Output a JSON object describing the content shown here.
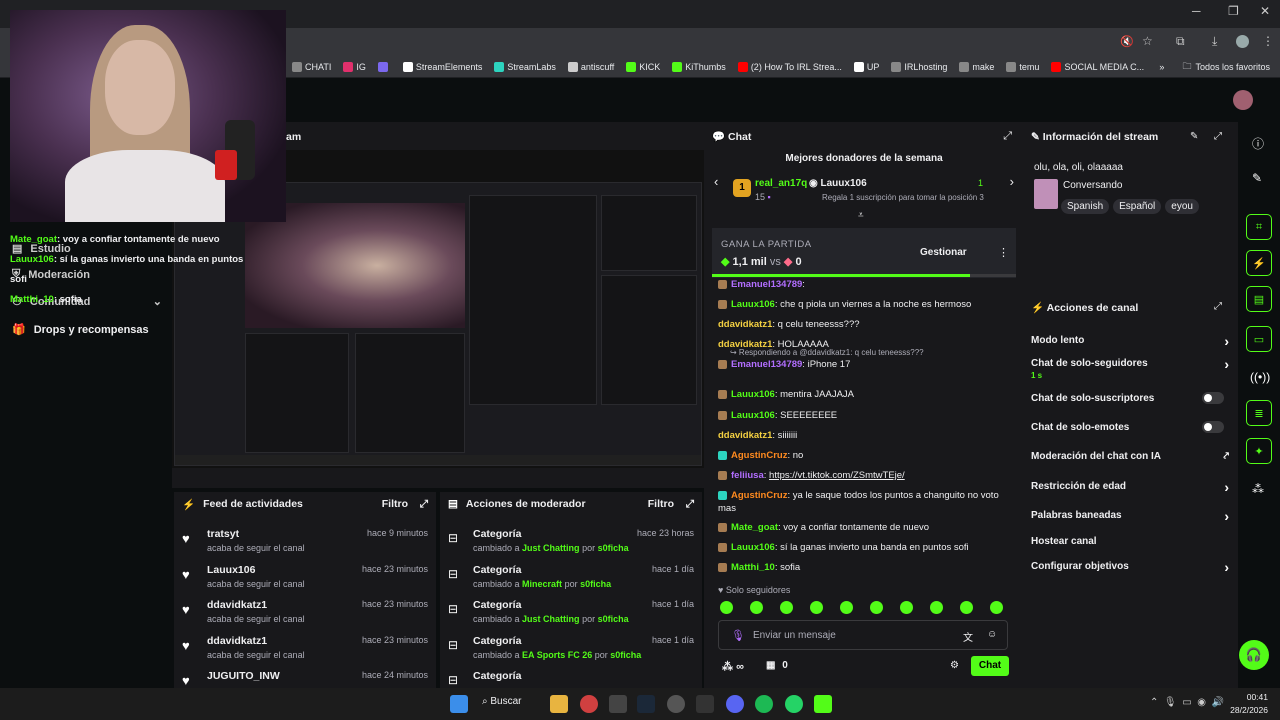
{
  "bookmarks": [
    "CHATI",
    "IG",
    "",
    "StreamElements",
    "StreamLabs",
    "antiscuff",
    "KICK",
    "KiThumbs",
    "(2) How To IRL Strea...",
    "UP",
    "IRLhosting",
    "make",
    "temu",
    "SOCIAL MEDIA C..."
  ],
  "bookmarks_right": "Todos los favoritos",
  "overlay_chat": [
    {
      "user": "Mate_goat",
      "text": "voy a confiar tontamente de nuevo"
    },
    {
      "user": "Lauux106",
      "text": "sí la ganas invierto una banda en puntos"
    },
    {
      "user": "",
      "text": "sofi"
    },
    {
      "user": "Matthi_10",
      "text": "sofia"
    }
  ],
  "left_nav": {
    "estudio": "Estudio",
    "moderacion": "Moderación",
    "comunidad": "Comunidad",
    "drops": "Drops y recompensas"
  },
  "stream_header_suffix": "am",
  "feed": {
    "title": "Feed de actividades",
    "filter": "Filtro",
    "items": [
      {
        "name": "tratsyt",
        "sub": "acaba de seguir el canal",
        "time": "hace 9 minutos"
      },
      {
        "name": "Lauux106",
        "sub": "acaba de seguir el canal",
        "time": "hace 23 minutos"
      },
      {
        "name": "ddavidkatz1",
        "sub": "acaba de seguir el canal",
        "time": "hace 23 minutos"
      },
      {
        "name": "ddavidkatz1",
        "sub": "acaba de seguir el canal",
        "time": "hace 23 minutos"
      },
      {
        "name": "JUGUITO_INW",
        "sub": "",
        "time": "hace 24 minutos"
      }
    ]
  },
  "modactions": {
    "title": "Acciones de moderador",
    "filter": "Filtro",
    "items": [
      {
        "name": "Categoría",
        "pre": "cambiado a",
        "cat": "Just Chatting",
        "mid": "por",
        "by": "s0ficha",
        "time": "hace 23 horas"
      },
      {
        "name": "Categoría",
        "pre": "cambiado a",
        "cat": "Minecraft",
        "mid": "por",
        "by": "s0ficha",
        "time": "hace 1 día"
      },
      {
        "name": "Categoría",
        "pre": "cambiado a",
        "cat": "Just Chatting",
        "mid": "por",
        "by": "s0ficha",
        "time": "hace 1 día"
      },
      {
        "name": "Categoría",
        "pre": "cambiado a",
        "cat": "EA Sports FC 26",
        "mid": "por",
        "by": "s0ficha",
        "time": "hace 1 día"
      },
      {
        "name": "Categoría",
        "pre": "",
        "cat": "",
        "mid": "",
        "by": "",
        "time": ""
      }
    ]
  },
  "chat": {
    "title": "Chat",
    "donors_title": "Mejores donadores de la semana",
    "donor1": {
      "name": "real_an17q",
      "count": "15"
    },
    "donor2": {
      "name": "Lauux106",
      "count": "1",
      "sub": "Regala 1 suscripción para tomar la posición 3"
    },
    "prediction": {
      "title": "GANA LA PARTIDA",
      "left": "1,1 mil",
      "vs": "vs",
      "right": "0",
      "manage": "Gestionar"
    },
    "messages": [
      {
        "user": "Emanuel134789",
        "cls": "u-purple",
        "text": ""
      },
      {
        "user": "Lauux106",
        "cls": "u-green",
        "text": "che q piola un viernes a la noche es hermoso"
      },
      {
        "user": "ddavidkatz1",
        "cls": "u-yellow",
        "text": "q celu teneesss???"
      },
      {
        "user": "ddavidkatz1",
        "cls": "u-yellow",
        "text": "HOLAAAAA"
      },
      {
        "user": "Emanuel134789",
        "cls": "u-purple",
        "text": "iPhone 17",
        "reply": "Respondiendo a @ddavidkatz1: q celu teneesss???"
      },
      {
        "user": "Lauux106",
        "cls": "u-green",
        "text": "mentira JAAJAJA"
      },
      {
        "user": "Lauux106",
        "cls": "u-green",
        "text": "SEEEEEEEE"
      },
      {
        "user": "ddavidkatz1",
        "cls": "u-yellow",
        "text": "siiiiiii"
      },
      {
        "user": "AgustinCruz",
        "cls": "u-orange",
        "text": "no"
      },
      {
        "user": "feliiusa",
        "cls": "u-purple",
        "text": "https://vt.tiktok.com/ZSmtwTEje/"
      },
      {
        "user": "AgustinCruz",
        "cls": "u-orange",
        "text": "ya le saque todos los puntos a changuito no voto mas"
      },
      {
        "user": "Mate_goat",
        "cls": "u-green",
        "text": "voy a confiar tontamente de nuevo"
      },
      {
        "user": "Lauux106",
        "cls": "u-green",
        "text": "sí la ganas invierto una banda en puntos sofi"
      },
      {
        "user": "Matthi_10",
        "cls": "u-green",
        "text": "sofia"
      }
    ],
    "followers_only": "Solo seguidores",
    "input_placeholder": "Enviar un mensaje",
    "points": "∞",
    "gifts": "0",
    "send": "Chat"
  },
  "info": {
    "title": "Información del stream",
    "stream_title": "olu, ola, oli, olaaaaa",
    "category": "Conversando",
    "tags": [
      "Spanish",
      "Español",
      "eyou"
    ]
  },
  "acciones": {
    "title": "Acciones de canal",
    "rows": [
      {
        "label": "Modo lento",
        "kind": "chev",
        "sub": ""
      },
      {
        "label": "Chat de solo-seguidores",
        "kind": "chev",
        "sub": "1 s"
      },
      {
        "label": "Chat de solo-suscriptores",
        "kind": "toggle",
        "sub": ""
      },
      {
        "label": "Chat de solo-emotes",
        "kind": "toggle",
        "sub": ""
      },
      {
        "label": "Moderación del chat con IA",
        "kind": "ext",
        "sub": ""
      },
      {
        "label": "Restricción de edad",
        "kind": "chev",
        "sub": ""
      },
      {
        "label": "Palabras baneadas",
        "kind": "chev",
        "sub": ""
      },
      {
        "label": "Hostear canal",
        "kind": "none",
        "sub": ""
      },
      {
        "label": "Configurar objetivos",
        "kind": "chev",
        "sub": ""
      }
    ]
  },
  "taskbar": {
    "search": "Buscar",
    "time": "00:41",
    "date": "28/2/2026"
  },
  "colors": {
    "accent": "#53fc18",
    "bg": "#18181b",
    "bg_dark": "#0b0e0f"
  }
}
